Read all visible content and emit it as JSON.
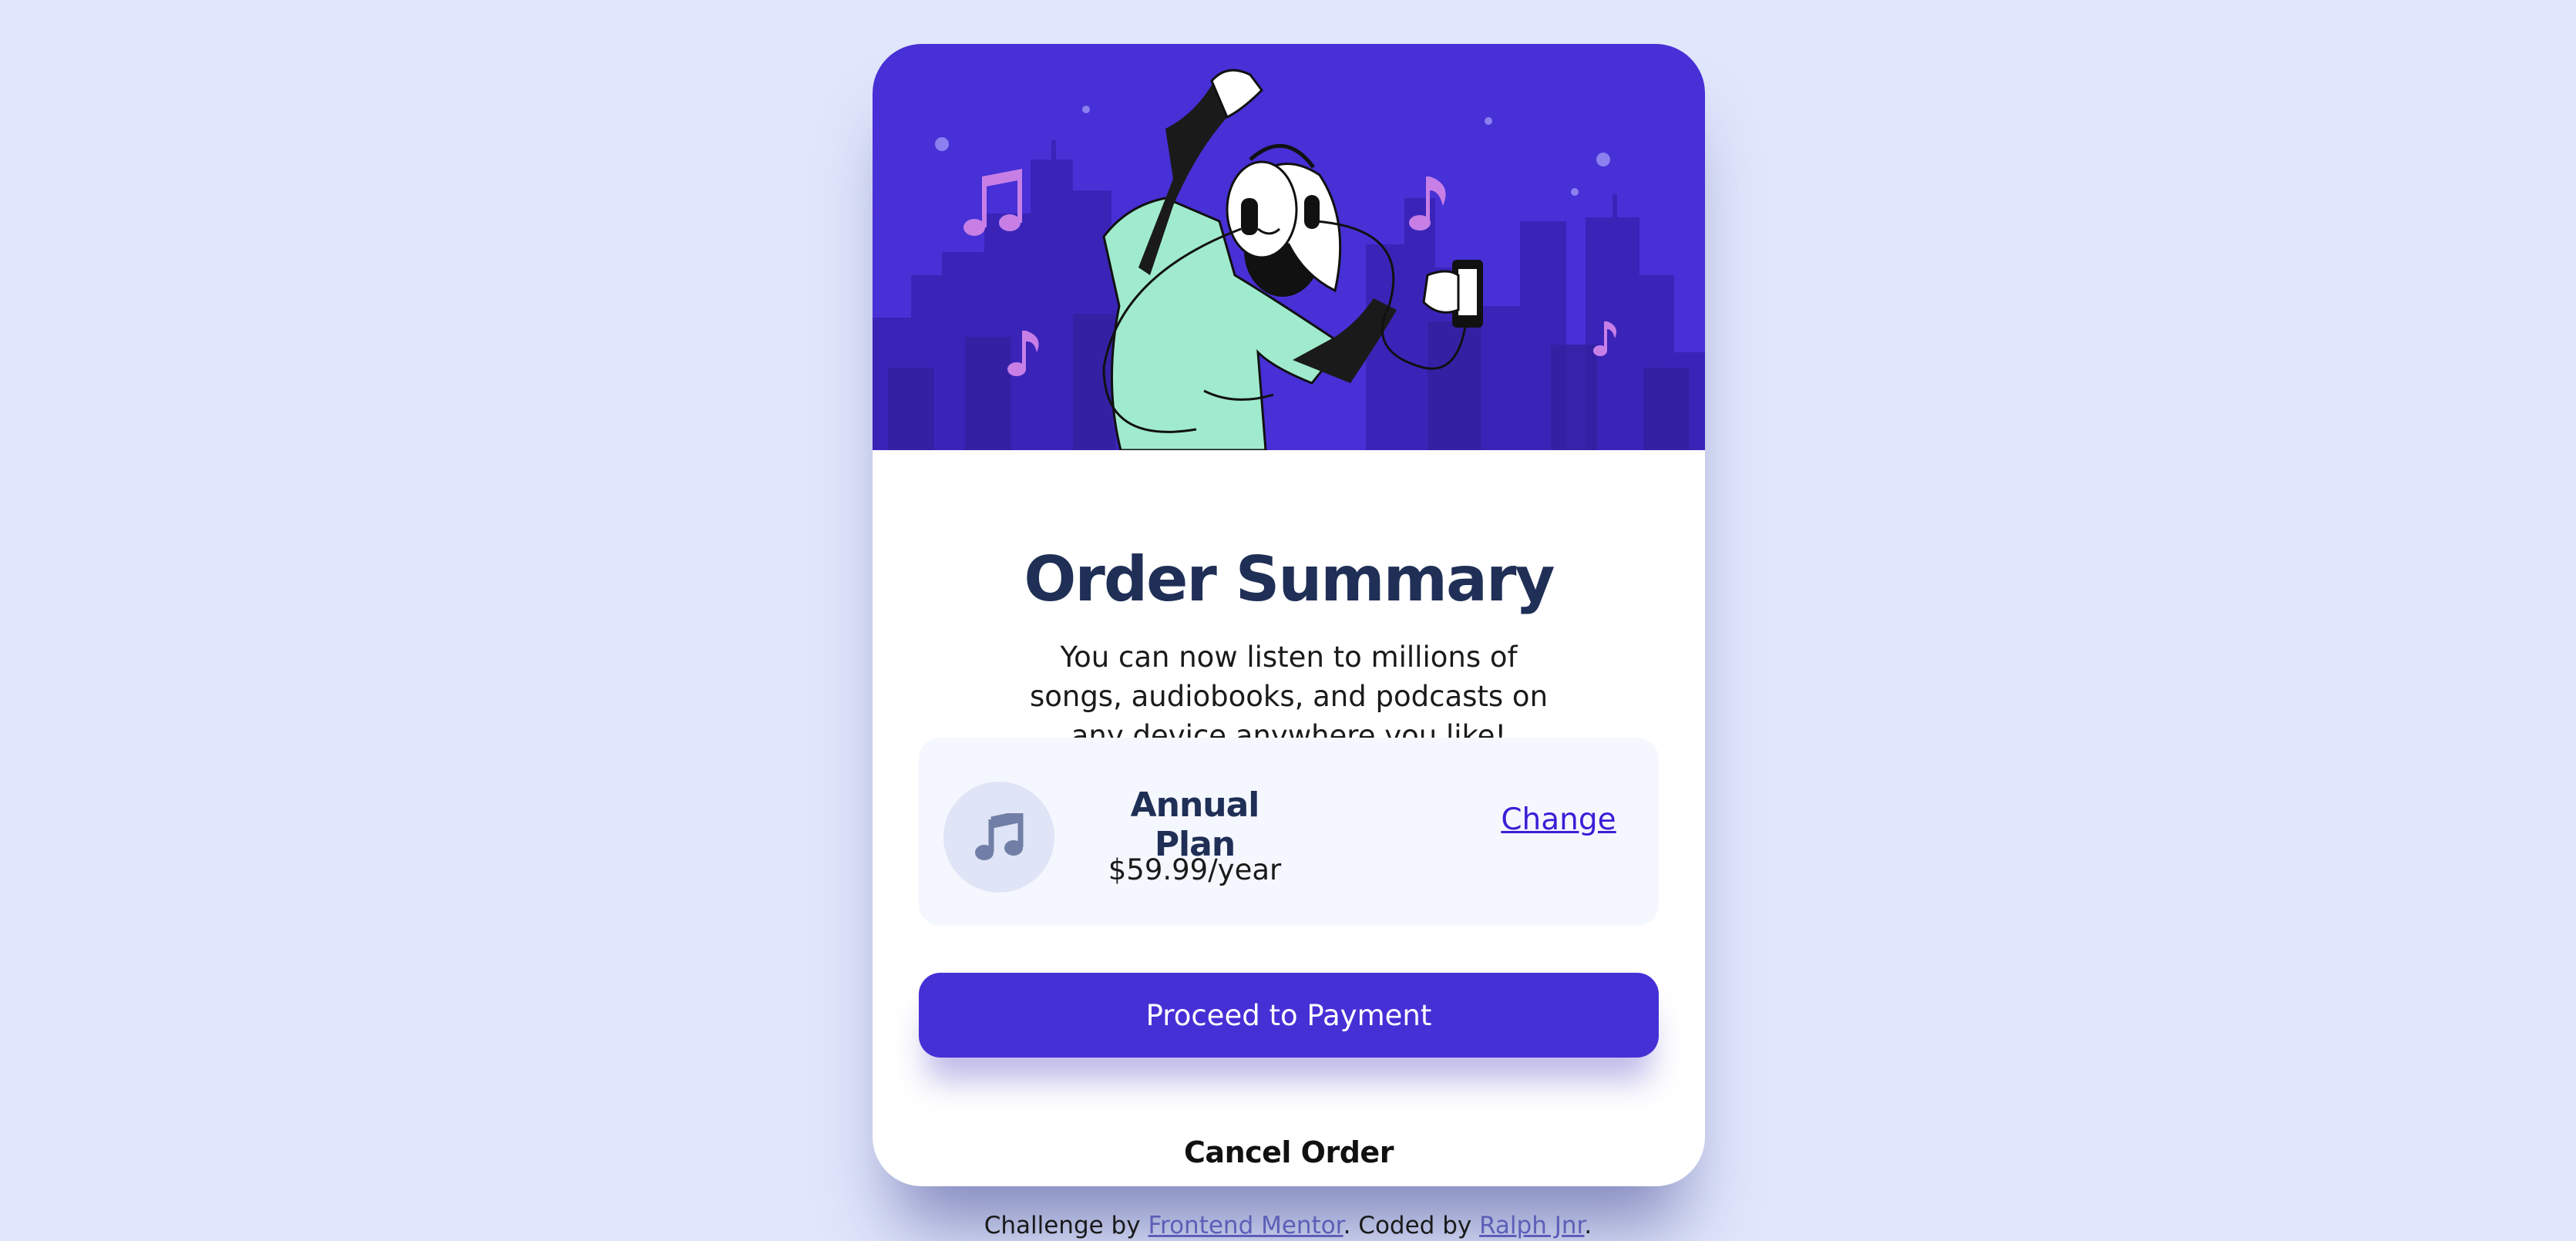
{
  "colors": {
    "page_background": "#e0e6fb",
    "hero_background": "#4730d6",
    "accent": "#4530d6",
    "link": "#3b1fd6",
    "title": "#1f2f56"
  },
  "hero": {
    "illustration": "woman-dancing-with-headphones-and-phone-over-city-skyline",
    "icons": [
      "music-note-icon"
    ]
  },
  "card": {
    "title": "Order Summary",
    "description": "You can now listen to millions of songs, audiobooks, and podcasts on any device anywhere you like!"
  },
  "plan": {
    "icon": "music-note-icon",
    "name": "Annual Plan",
    "price": "$59.99/year",
    "change_label": "Change"
  },
  "actions": {
    "proceed_label": "Proceed to Payment",
    "cancel_label": "Cancel Order"
  },
  "footer": {
    "prefix": "Challenge by ",
    "challenge_link": "Frontend Mentor",
    "middle": ". Coded by ",
    "author_link": "Ralph Jnr",
    "suffix": "."
  }
}
